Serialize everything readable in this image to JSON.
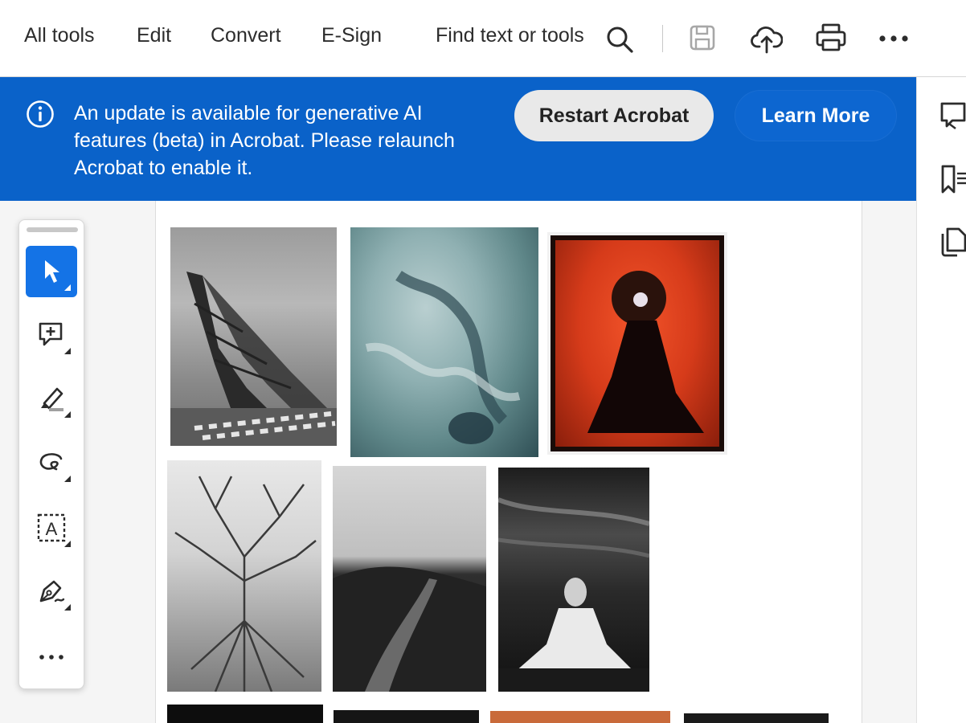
{
  "toolbar": {
    "menu": [
      "All tools",
      "Edit",
      "Convert",
      "E-Sign"
    ],
    "find_label": "Find text or tools",
    "icons": [
      "search-icon",
      "save-icon",
      "upload-icon",
      "print-icon",
      "more-icon"
    ]
  },
  "banner": {
    "message": "An update is available for generative AI features (beta) in Acrobat. Please relaunch Acrobat to enable it.",
    "restart_label": "Restart Acrobat",
    "learn_label": "Learn More",
    "color": "#0a62c9"
  },
  "tool_panel": {
    "tools": [
      "select-tool",
      "add-comment-tool",
      "highlight-tool",
      "draw-tool",
      "text-box-tool",
      "sign-tool",
      "more-tools"
    ],
    "selected": "select-tool"
  },
  "right_rail": {
    "icons": [
      "comments-icon",
      "bookmarks-icon",
      "pages-icon"
    ]
  },
  "document": {
    "images": [
      "eiffel-tower-photo",
      "abstract-teal-photo",
      "red-costume-photo",
      "bare-tree-photo",
      "hill-path-photo",
      "woman-by-sea-photo",
      "bottom-photo-1",
      "bottom-photo-2",
      "bottom-photo-3",
      "bottom-photo-4"
    ]
  },
  "colors": {
    "accent": "#1473e6",
    "banner": "#0a62c9",
    "text": "#2c2c2c"
  }
}
